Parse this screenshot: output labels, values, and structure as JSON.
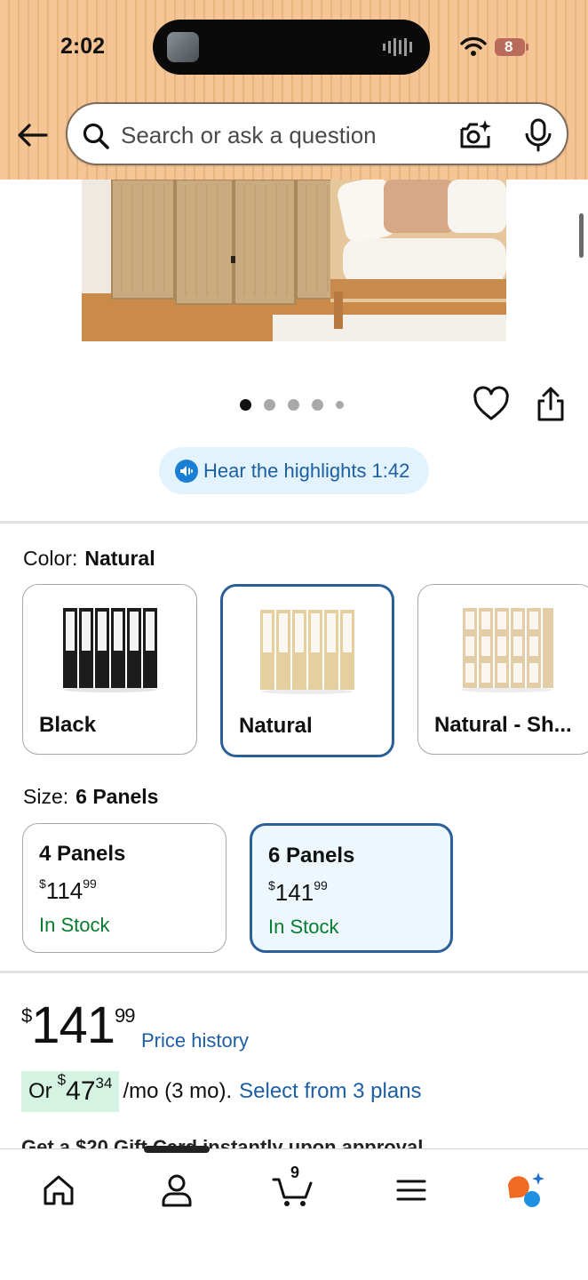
{
  "status_bar": {
    "time": "2:02",
    "battery": "8"
  },
  "search": {
    "placeholder": "Search or ask a question"
  },
  "carousel": {
    "dot_count": 5,
    "active_index": 0
  },
  "audio": {
    "label": "Hear the highlights 1:42"
  },
  "color": {
    "label": "Color:",
    "selected": "Natural",
    "options": [
      {
        "label": "Black"
      },
      {
        "label": "Natural"
      },
      {
        "label": "Natural - Sh..."
      }
    ]
  },
  "size": {
    "label": "Size:",
    "selected": "6 Panels",
    "options": [
      {
        "name": "4 Panels",
        "price_dollar": "$",
        "price_whole": "114",
        "price_cents": "99",
        "stock": "In Stock"
      },
      {
        "name": "6 Panels",
        "price_dollar": "$",
        "price_whole": "141",
        "price_cents": "99",
        "stock": "In Stock"
      }
    ]
  },
  "price": {
    "dollar": "$",
    "whole": "141",
    "cents": "99",
    "history_link": "Price history"
  },
  "installment": {
    "prefix": "Or",
    "dollar": "$",
    "whole": "47",
    "cents": "34",
    "term": "/mo (3 mo).",
    "link": "Select from 3 plans"
  },
  "partial_text": "Get a $20 Gift Card instantly upon approval",
  "nav": {
    "cart_count": "9"
  },
  "colors": {
    "link": "#1d5fa3",
    "selected_border": "#2a5f99",
    "in_stock": "#067d2e",
    "header_bg": "#f5c596"
  }
}
